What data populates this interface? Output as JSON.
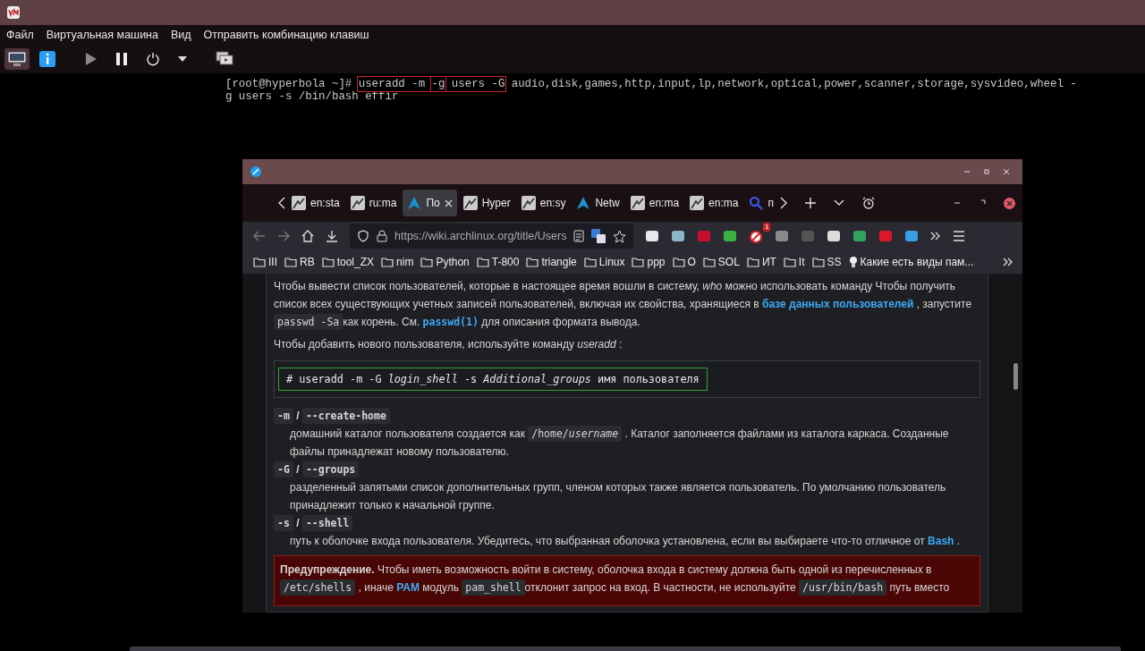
{
  "vm_window": {
    "menu": [
      "Файл",
      "Виртуальная машина",
      "Вид",
      "Отправить комбинацию клавиш"
    ],
    "view_buttons": [
      {
        "kind": "console",
        "selected": true
      },
      {
        "kind": "details",
        "selected": false
      }
    ]
  },
  "terminal": {
    "lines": [
      {
        "parts": [
          {
            "kind": "text",
            "text": "[root@hyperbola ~]# "
          },
          {
            "kind": "frame",
            "parts": [
              {
                "kind": "text",
                "text": "useradd -m "
              },
              {
                "kind": "boxed",
                "text": "-g"
              },
              {
                "kind": "text",
                "text": " users -G"
              }
            ]
          },
          {
            "kind": "text",
            "text": " audio,disk,games,http,input,lp,network,optical,power,scanner,storage,sysvideo,wheel -"
          }
        ]
      },
      {
        "parts": [
          {
            "kind": "text",
            "text": "g users -s /bin/bash effir"
          }
        ]
      }
    ]
  },
  "browser": {
    "tabs": [
      {
        "kind": "wiki",
        "label": "en:sta",
        "selected": false
      },
      {
        "kind": "wiki",
        "label": "ru:ma",
        "selected": false
      },
      {
        "kind": "arch",
        "label": "По",
        "selected": true
      },
      {
        "kind": "wiki",
        "label": "Hyper",
        "selected": false
      },
      {
        "kind": "wiki",
        "label": "en:sy",
        "selected": false
      },
      {
        "kind": "arch",
        "label": "Netw",
        "selected": false
      },
      {
        "kind": "wiki",
        "label": "en:ma",
        "selected": false
      },
      {
        "kind": "wiki",
        "label": "en:ma",
        "selected": false
      },
      {
        "kind": "search",
        "label": "п",
        "selected": false
      }
    ],
    "url": {
      "value": "https://wiki.archlinux.org/title/Users"
    },
    "extension_badge": "1",
    "bookmarks": [
      {
        "kind": "folder",
        "label": "III"
      },
      {
        "kind": "folder",
        "label": "RB"
      },
      {
        "kind": "folder",
        "label": "tool_ZX"
      },
      {
        "kind": "folder",
        "label": "nim"
      },
      {
        "kind": "folder",
        "label": "Python"
      },
      {
        "kind": "folder",
        "label": "T-800"
      },
      {
        "kind": "folder",
        "label": "triangle"
      },
      {
        "kind": "folder",
        "label": "Linux"
      },
      {
        "kind": "folder",
        "label": "ppp"
      },
      {
        "kind": "folder",
        "label": "O"
      },
      {
        "kind": "folder",
        "label": "SOL"
      },
      {
        "kind": "folder",
        "label": "ИТ"
      },
      {
        "kind": "folder",
        "label": "It"
      },
      {
        "kind": "folder",
        "label": "SS"
      },
      {
        "kind": "page",
        "label": "Какие есть виды пам..."
      }
    ],
    "content": [
      {
        "kind": "paragraph",
        "segments": [
          {
            "kind": "text",
            "text": "Чтобы вывести список пользователей, которые в настоящее время вошли в систему, "
          },
          {
            "kind": "em",
            "text": "who"
          },
          {
            "kind": "text",
            "text": " можно использовать команду Чтобы получить список всех существующих учетных записей пользователей, включая их свойства, хранящиеся в "
          },
          {
            "kind": "link",
            "text": "базе данных пользователей"
          },
          {
            "kind": "text",
            "text": " , запустите "
          },
          {
            "kind": "code",
            "text": "passwd -Sa"
          },
          {
            "kind": "text",
            "text": "как корень. См. "
          },
          {
            "kind": "codelink",
            "text": "passwd(1)"
          },
          {
            "kind": "text",
            "text": " для описания формата вывода."
          }
        ]
      },
      {
        "kind": "paragraph",
        "segments": [
          {
            "kind": "text",
            "text": "Чтобы добавить нового пользователя, используйте команду "
          },
          {
            "kind": "em",
            "text": "useradd"
          },
          {
            "kind": "text",
            "text": " :"
          }
        ]
      },
      {
        "kind": "codeblock",
        "text": "# useradd -m -G *login_shell* -s *Additional_groups*  имя пользователя"
      },
      {
        "kind": "term",
        "segments": [
          {
            "kind": "code",
            "text": "-m"
          },
          {
            "kind": "text",
            "text": " / "
          },
          {
            "kind": "code",
            "text": "--create-home"
          }
        ]
      },
      {
        "kind": "description",
        "segments": [
          {
            "kind": "text",
            "text": "домашний каталог пользователя создается как "
          },
          {
            "kind": "code",
            "text": "/home/*username*"
          },
          {
            "kind": "text",
            "text": " . Каталог заполняется файлами из каталога каркаса. Созданные файлы принадлежат новому пользователю."
          }
        ]
      },
      {
        "kind": "term",
        "segments": [
          {
            "kind": "code",
            "text": "-G"
          },
          {
            "kind": "text",
            "text": " / "
          },
          {
            "kind": "code",
            "text": "--groups"
          }
        ]
      },
      {
        "kind": "description",
        "segments": [
          {
            "kind": "text",
            "text": "разделенный запятыми список дополнительных групп, членом которых также является пользователь. По умолчанию пользователь принадлежит только к начальной группе."
          }
        ]
      },
      {
        "kind": "term",
        "segments": [
          {
            "kind": "code",
            "text": "-s"
          },
          {
            "kind": "text",
            "text": " / "
          },
          {
            "kind": "code",
            "text": "--shell"
          }
        ]
      },
      {
        "kind": "description",
        "segments": [
          {
            "kind": "text",
            "text": "путь к оболочке входа пользователя. Убедитесь, что выбранная оболочка установлена, если вы выбираете что-то отличное от "
          },
          {
            "kind": "link",
            "text": "Bash"
          },
          {
            "kind": "text",
            "text": " ."
          }
        ]
      },
      {
        "kind": "warning",
        "segments": [
          {
            "kind": "strong",
            "text": "Предупреждение."
          },
          {
            "kind": "text",
            "text": " Чтобы иметь возможность войти в систему, оболочка входа в систему должна быть одной из перечисленных в "
          },
          {
            "kind": "code",
            "text": "/etc/shells"
          },
          {
            "kind": "text",
            "text": " , иначе "
          },
          {
            "kind": "link",
            "text": "PAM"
          },
          {
            "kind": "text",
            "text": " модуль "
          },
          {
            "kind": "code",
            "text": "pam_shell"
          },
          {
            "kind": "text",
            "text": "отклонит запрос на вход. В частности, не используйте "
          },
          {
            "kind": "code",
            "text": "/usr/bin/bash"
          },
          {
            "kind": "text",
            "text": " путь вместо"
          }
        ]
      }
    ]
  }
}
